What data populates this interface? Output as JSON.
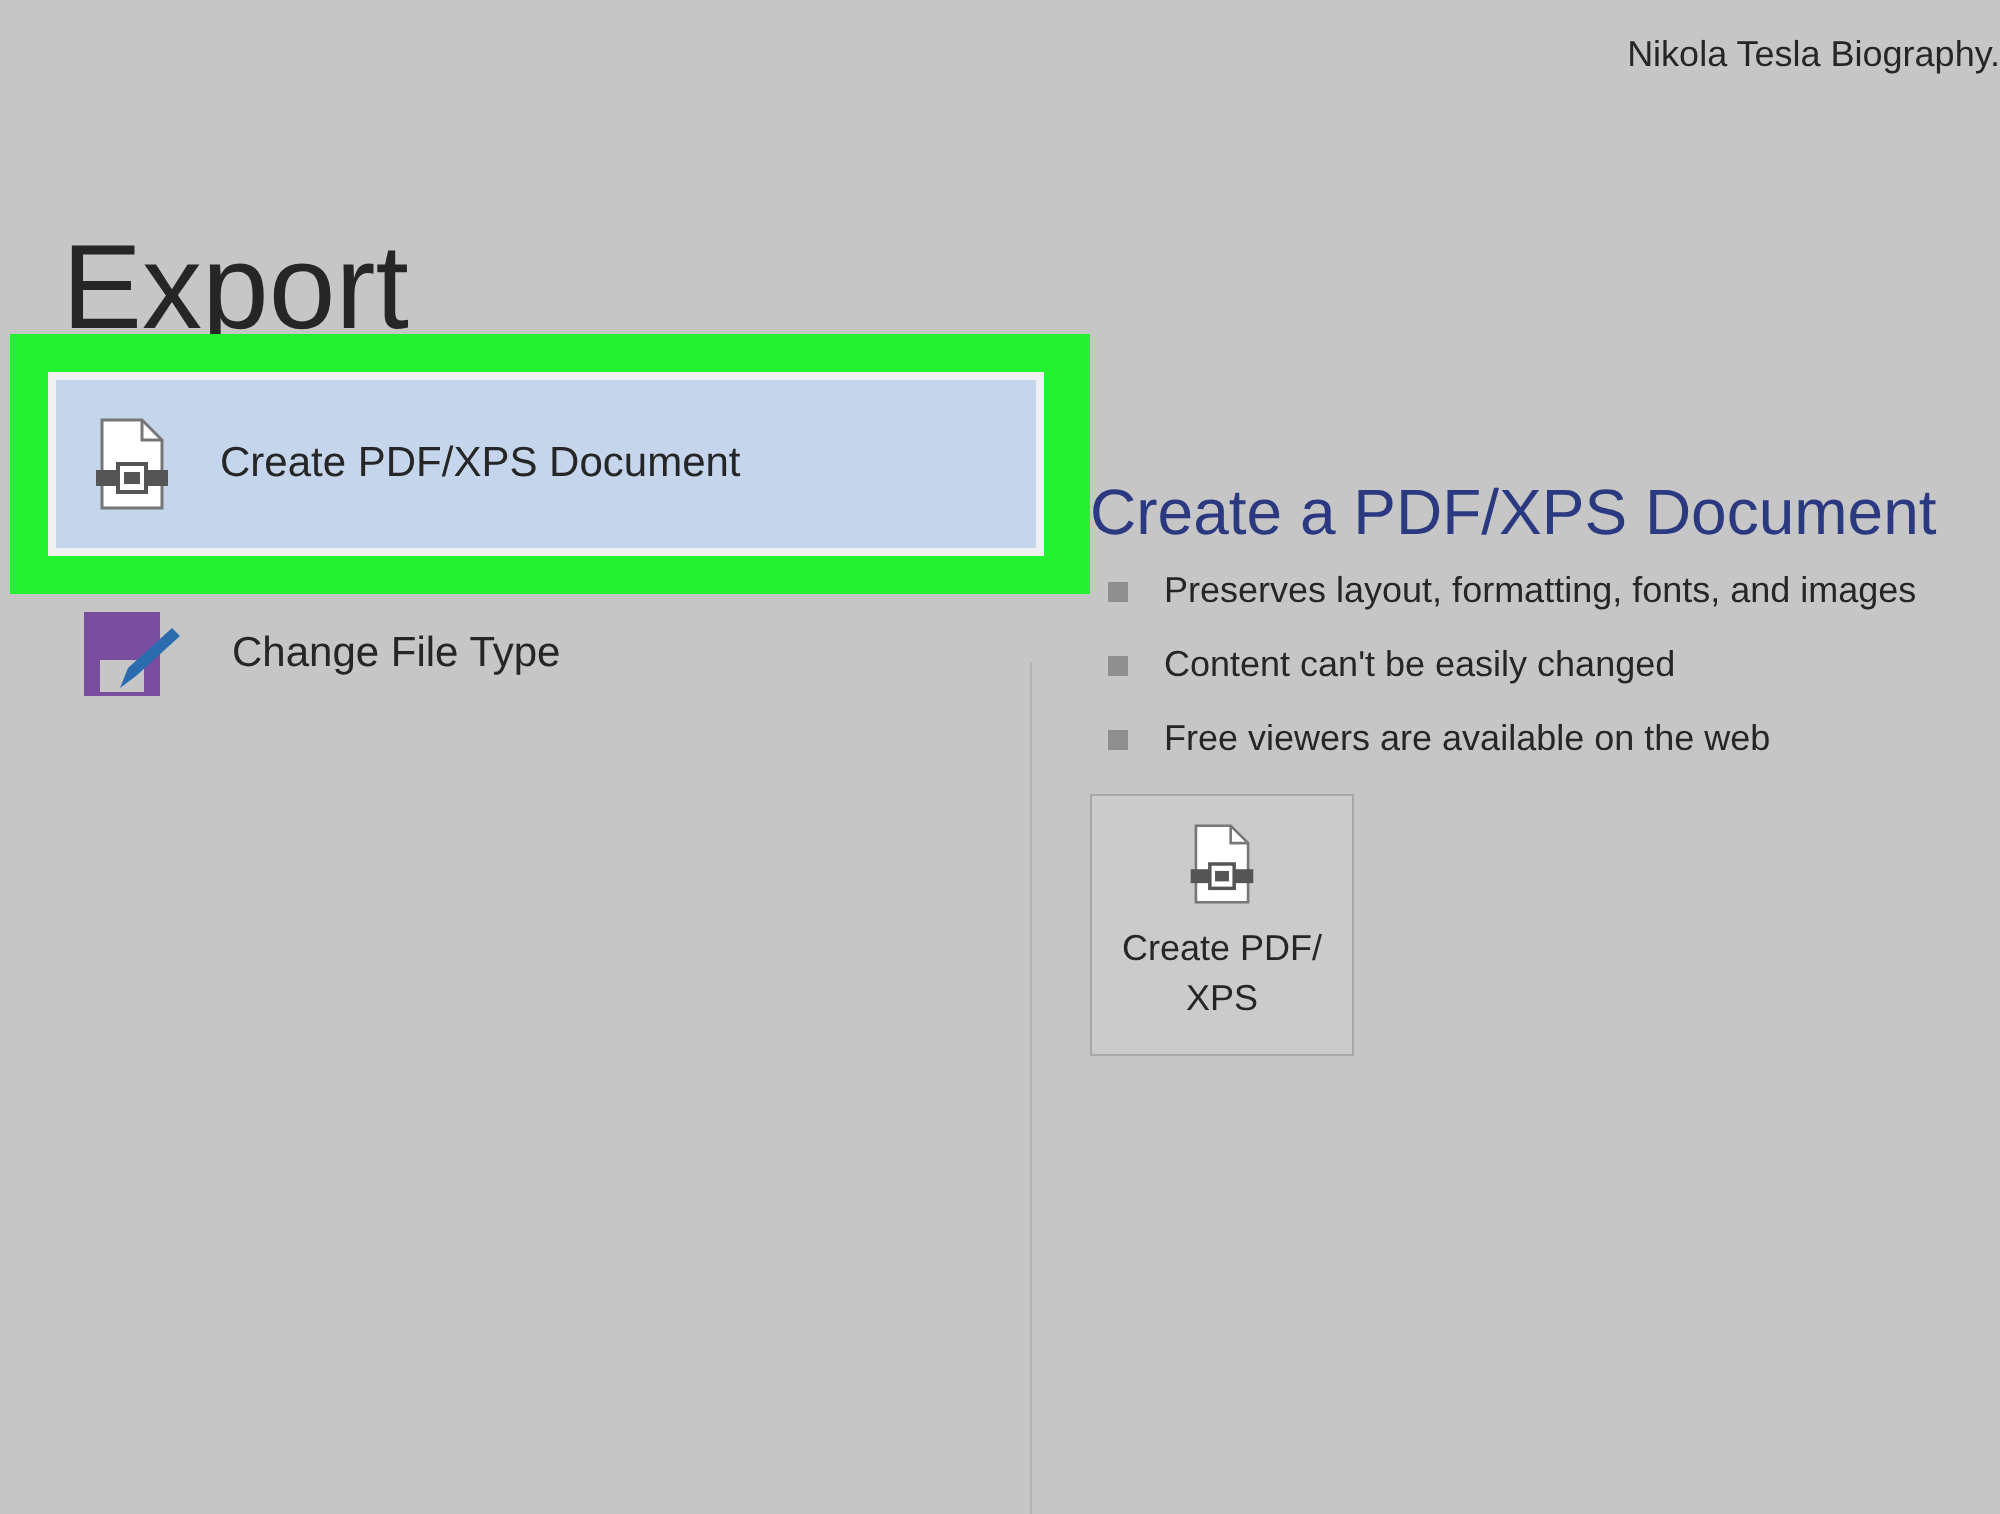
{
  "window": {
    "title": "Nikola Tesla Biography."
  },
  "heading": "Export",
  "options": [
    {
      "kind": "pdf",
      "label": "Create PDF/XPS Document",
      "selected": true,
      "highlighted": true
    },
    {
      "kind": "filetype",
      "label": "Change File Type",
      "selected": false,
      "highlighted": false
    }
  ],
  "detail": {
    "title": "Create a PDF/XPS Document",
    "bullets": [
      "Preserves layout, formatting, fonts, and images",
      "Content can't be easily changed",
      "Free viewers are available on the web"
    ],
    "button": "Create PDF/ XPS"
  }
}
